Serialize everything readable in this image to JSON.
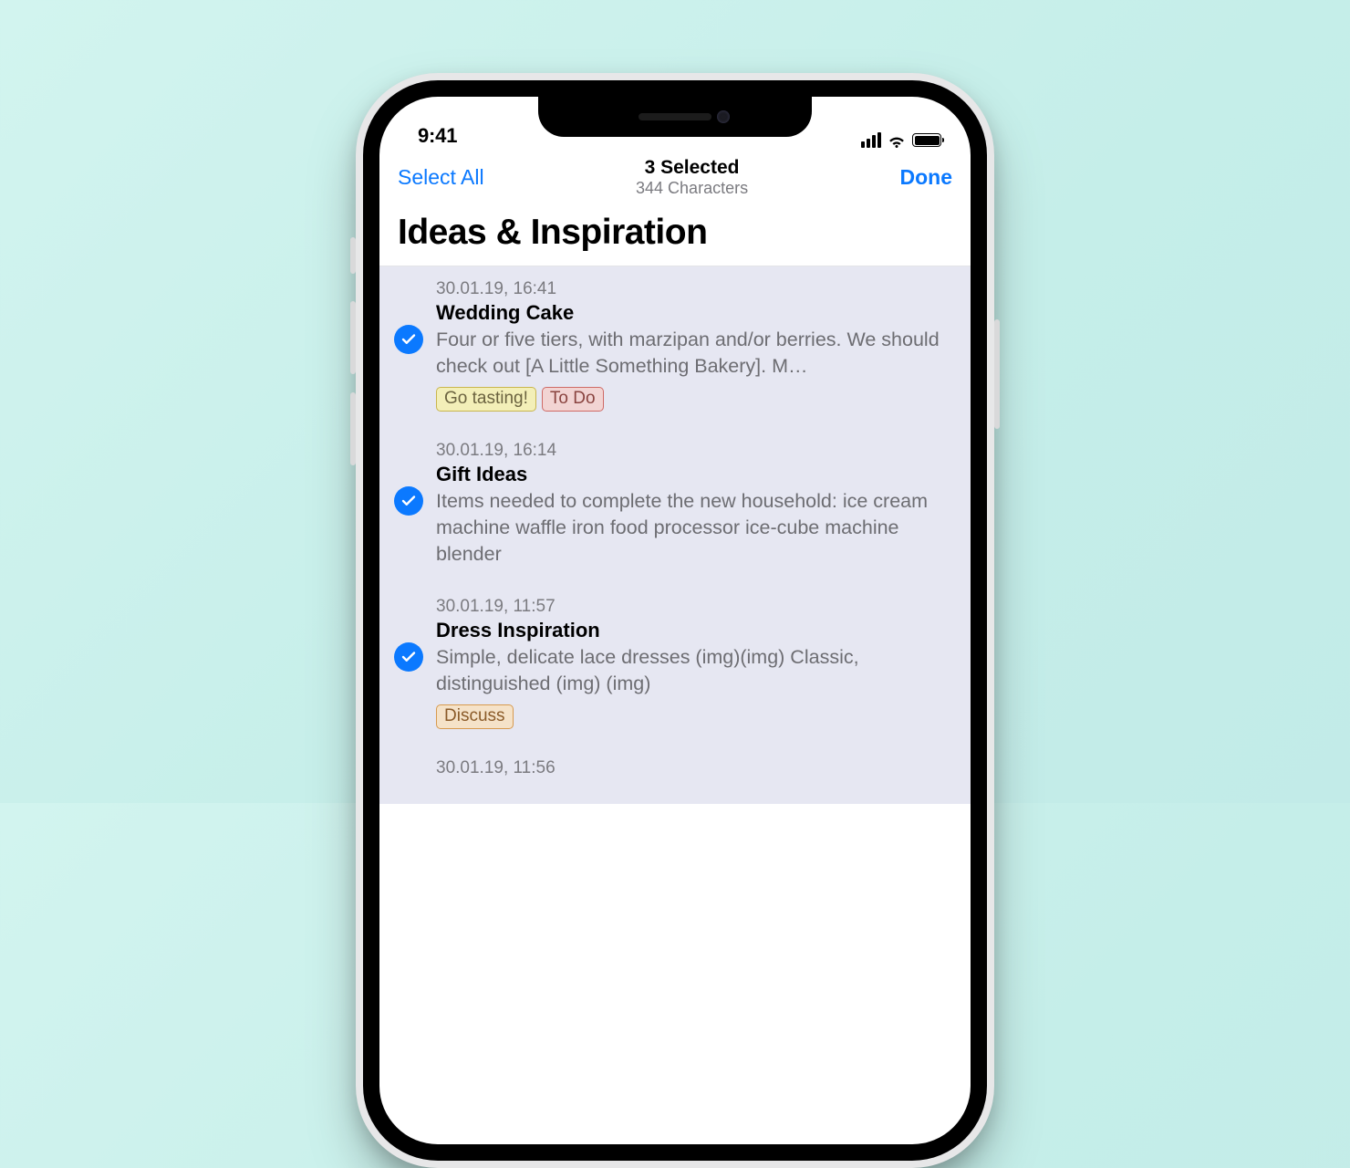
{
  "status": {
    "time": "9:41"
  },
  "nav": {
    "select_all": "Select All",
    "title": "3 Selected",
    "subtitle": "344 Characters",
    "done": "Done"
  },
  "page": {
    "title": "Ideas & Inspiration"
  },
  "items": [
    {
      "date": "30.01.19, 16:41",
      "title": "Wedding Cake",
      "preview": "Four or five tiers, with marzipan and/or berries. We should check out [A Little Something Bakery]. M…",
      "tags": [
        {
          "label": "Go tasting!",
          "tone": "yellow"
        },
        {
          "label": "To Do",
          "tone": "red"
        }
      ]
    },
    {
      "date": "30.01.19, 16:14",
      "title": "Gift Ideas",
      "preview": "Items needed to complete the new household: ice cream machine waffle iron food processor ice-cube machine blender",
      "tags": []
    },
    {
      "date": "30.01.19, 11:57",
      "title": "Dress Inspiration",
      "preview": "Simple, delicate lace dresses (img)(img) Classic, distinguished (img) (img)",
      "tags": [
        {
          "label": "Discuss",
          "tone": "orange"
        }
      ]
    },
    {
      "date": "30.01.19, 11:56",
      "title": "",
      "preview": "",
      "tags": []
    }
  ]
}
